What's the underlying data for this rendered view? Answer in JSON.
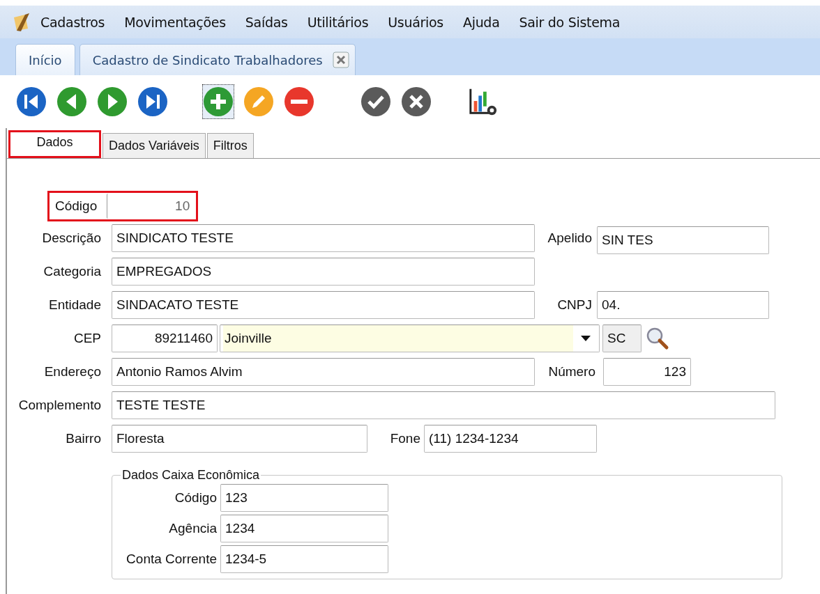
{
  "menu": [
    {
      "label": "Cadastros"
    },
    {
      "label": "Movimentações"
    },
    {
      "label": "Saídas"
    },
    {
      "label": "Utilitários"
    },
    {
      "label": "Usuários"
    },
    {
      "label": "Ajuda"
    },
    {
      "label": "Sair do Sistema"
    }
  ],
  "doc_tabs": [
    {
      "label": "Início",
      "selected": false,
      "closable": false
    },
    {
      "label": "Cadastro de Sindicato Trabalhadores",
      "selected": true,
      "closable": true
    }
  ],
  "toolbar": [
    {
      "kind": "first",
      "focused": false
    },
    {
      "kind": "prev",
      "focused": false
    },
    {
      "kind": "next",
      "focused": false
    },
    {
      "kind": "last",
      "focused": false
    },
    {
      "kind": "add",
      "focused": true
    },
    {
      "kind": "edit",
      "focused": false
    },
    {
      "kind": "delete",
      "focused": false
    },
    {
      "kind": "confirm",
      "focused": false
    },
    {
      "kind": "cancel",
      "focused": false
    },
    {
      "kind": "report",
      "focused": false
    }
  ],
  "form_tabs": [
    {
      "label": "Dados",
      "selected": true,
      "highlighted": true
    },
    {
      "label": "Dados Variáveis",
      "selected": false,
      "highlighted": false
    },
    {
      "label": "Filtros",
      "selected": false,
      "highlighted": false
    }
  ],
  "form": {
    "codigo": {
      "label": "Código",
      "value": "10",
      "highlighted": true
    },
    "descricao": {
      "label": "Descrição",
      "value": "SINDICATO TESTE"
    },
    "apelido": {
      "label": "Apelido",
      "value": "SIN TES"
    },
    "categoria": {
      "label": "Categoria",
      "value": "EMPREGADOS"
    },
    "entidade": {
      "label": "Entidade",
      "value": "SINDACATO TESTE"
    },
    "cnpj": {
      "label": "CNPJ",
      "value": "04."
    },
    "cep": {
      "label": "CEP",
      "value": "89211460"
    },
    "cidade": {
      "value": "Joinville"
    },
    "uf": {
      "value": "SC"
    },
    "endereco": {
      "label": "Endereço",
      "value": "Antonio Ramos Alvim"
    },
    "numero": {
      "label": "Número",
      "value": "123"
    },
    "complemento": {
      "label": "Complemento",
      "value": "TESTE TESTE"
    },
    "bairro": {
      "label": "Bairro",
      "value": "Floresta"
    },
    "fone": {
      "label": "Fone",
      "value": "(11) 1234-1234"
    }
  },
  "caixa": {
    "title": "Dados Caixa Econômica",
    "fields": [
      {
        "label": "Código",
        "value": "123"
      },
      {
        "label": "Agência",
        "value": "1234"
      },
      {
        "label": "Conta Corrente",
        "value": "1234-5"
      }
    ]
  }
}
